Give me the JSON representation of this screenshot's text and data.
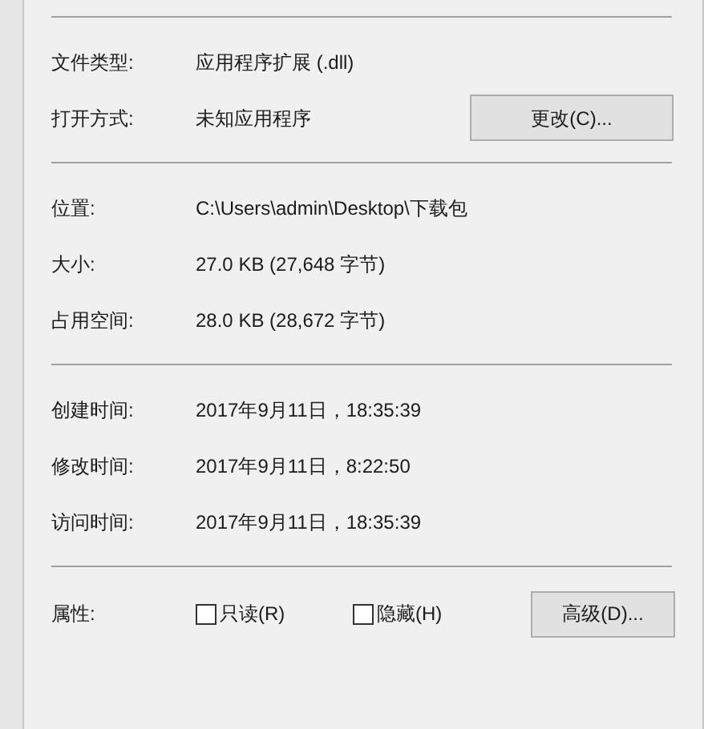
{
  "sections": [
    {
      "rows": [
        {
          "label": "文件类型:",
          "value": "应用程序扩展 (.dll)"
        },
        {
          "label": "打开方式:",
          "value": "未知应用程序",
          "button": "更改(C)..."
        }
      ]
    },
    {
      "rows": [
        {
          "label": "位置:",
          "value": "C:\\Users\\admin\\Desktop\\下载包"
        },
        {
          "label": "大小:",
          "value": "27.0 KB (27,648 字节)"
        },
        {
          "label": "占用空间:",
          "value": "28.0 KB (28,672 字节)"
        }
      ]
    },
    {
      "rows": [
        {
          "label": "创建时间:",
          "value": "2017年9月11日，18:35:39"
        },
        {
          "label": "修改时间:",
          "value": "2017年9月11日，8:22:50"
        },
        {
          "label": "访问时间:",
          "value": "2017年9月11日，18:35:39"
        }
      ]
    }
  ],
  "attributes": {
    "label": "属性:",
    "checkboxes": [
      {
        "label": "只读(R)",
        "checked": false
      },
      {
        "label": "隐藏(H)",
        "checked": false
      }
    ],
    "button": "高级(D)..."
  }
}
